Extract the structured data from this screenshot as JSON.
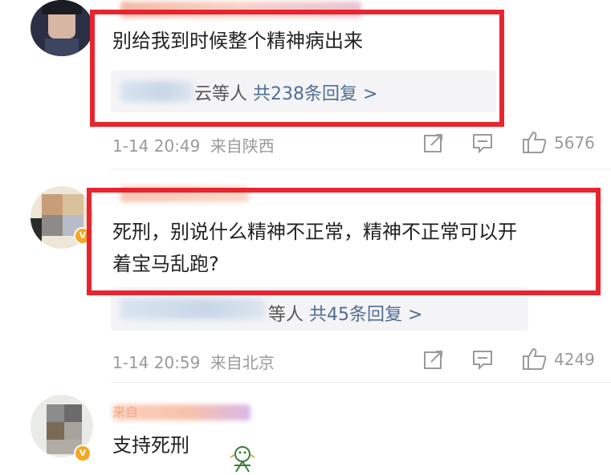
{
  "comments": [
    {
      "text_lines": [
        "别给我到时候整个精神病出来"
      ],
      "replies_suffix": "云等人",
      "replies_count": "共238条回复 >",
      "time": "1-14 20:49",
      "location": "来自陕西",
      "likes": "5676"
    },
    {
      "text_lines": [
        "死刑，别说什么精神不正常，精神不正常可以开",
        "着宝马乱跑?"
      ],
      "replies_suffix": "等人",
      "replies_count": "共45条回复 >",
      "time": "1-14 20:59",
      "location": "来自北京",
      "likes": "4249"
    },
    {
      "text_lines": [
        "支持死刑"
      ],
      "name_partial": "来自"
    }
  ],
  "icons": {
    "share": "share-icon",
    "comment": "comment-icon",
    "like": "thumbs-up-icon",
    "verified": "verified-badge-icon"
  },
  "colors": {
    "highlight_box": "#e8252f",
    "reply_link": "#4f6e93",
    "meta_gray": "#9a9a9a"
  }
}
